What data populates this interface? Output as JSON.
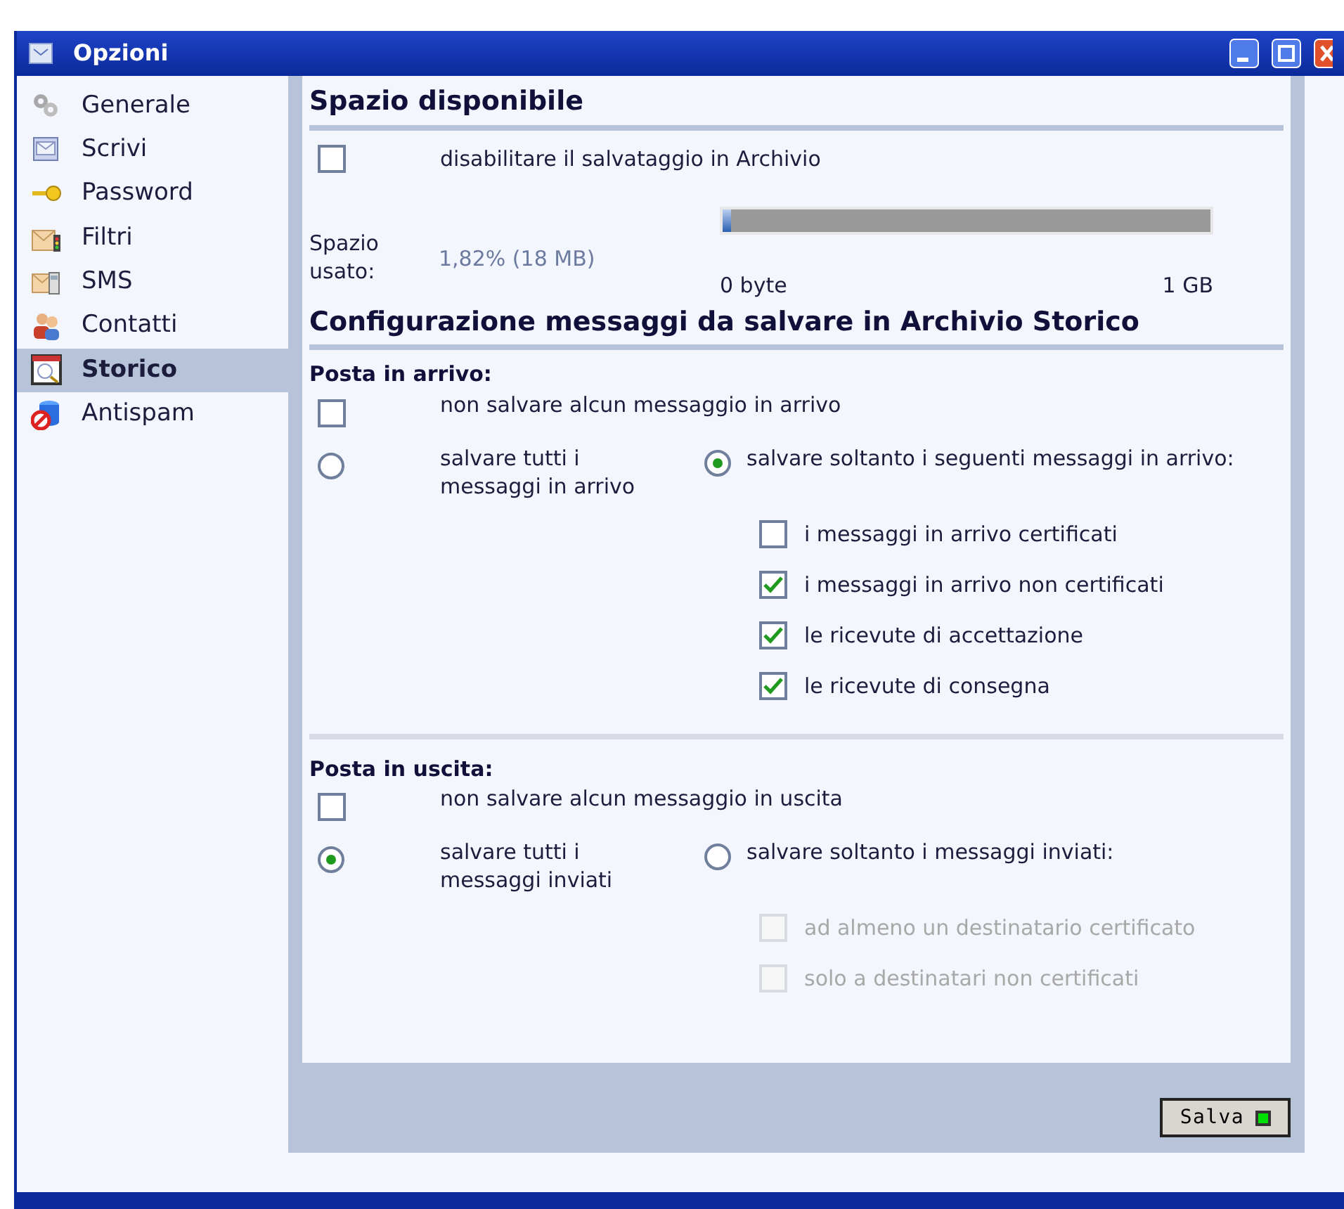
{
  "window": {
    "title": "Opzioni"
  },
  "sidebar": {
    "items": [
      {
        "label": "Generale",
        "selected": false
      },
      {
        "label": "Scrivi",
        "selected": false
      },
      {
        "label": "Password",
        "selected": false
      },
      {
        "label": "Filtri",
        "selected": false
      },
      {
        "label": "SMS",
        "selected": false
      },
      {
        "label": "Contatti",
        "selected": false
      },
      {
        "label": "Storico",
        "selected": true
      },
      {
        "label": "Antispam",
        "selected": false
      }
    ]
  },
  "space": {
    "title": "Spazio disponibile",
    "disable_option": {
      "label": "disabilitare il salvataggio in Archivio",
      "checked": false
    },
    "usage": {
      "label": "Spazio usato:",
      "value": "1,82% (18 MB)",
      "level": 0.0182,
      "min_label": "0 byte",
      "max_label": "1 GB"
    }
  },
  "config": {
    "title": "Configurazione messaggi da salvare in Archivio Storico",
    "groups": [
      {
        "title": "Posta in arrivo:",
        "none_option": {
          "label": "non salvare alcun messaggio in arrivo",
          "checked": false
        },
        "radios": [
          {
            "label": "salvare tutti i messaggi in arrivo",
            "selected": false
          },
          {
            "label": "salvare soltanto i seguenti messaggi in arrivo:",
            "selected": true
          }
        ],
        "sub_options": [
          {
            "label": "i messaggi in arrivo certificati",
            "checked": false,
            "disabled": false
          },
          {
            "label": "i messaggi in arrivo non certificati",
            "checked": true,
            "disabled": false
          },
          {
            "label": "le ricevute di accettazione",
            "checked": true,
            "disabled": false
          },
          {
            "label": "le ricevute di consegna",
            "checked": true,
            "disabled": false
          }
        ]
      },
      {
        "title": "Posta in uscita:",
        "none_option": {
          "label": "non salvare alcun messaggio in uscita",
          "checked": false
        },
        "radios": [
          {
            "label": "salvare tutti i messaggi inviati",
            "selected": true
          },
          {
            "label": "salvare soltanto i messaggi inviati:",
            "selected": false
          }
        ],
        "sub_options": [
          {
            "label": "ad almeno un destinatario certificato",
            "checked": false,
            "disabled": true
          },
          {
            "label": "solo a destinatari non certificati",
            "checked": false,
            "disabled": true
          }
        ]
      }
    ]
  },
  "save_button": {
    "label": "Salva"
  }
}
